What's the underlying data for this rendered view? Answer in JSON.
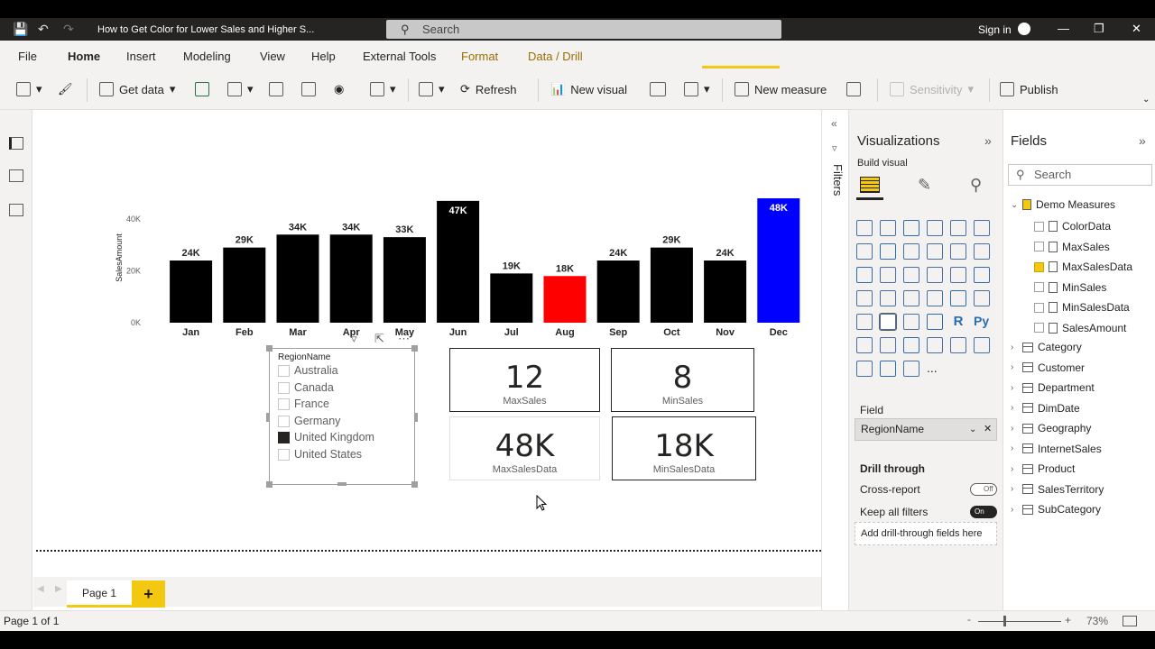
{
  "titlebar": {
    "title": "How to Get Color for Lower Sales and Higher S...",
    "search": "Search",
    "signin": "Sign in"
  },
  "menu": [
    "File",
    "Home",
    "Insert",
    "Modeling",
    "View",
    "Help",
    "External Tools",
    "Format",
    "Data / Drill"
  ],
  "ribbon": {
    "get_data": "Get data",
    "refresh": "Refresh",
    "new_visual": "New visual",
    "new_measure": "New measure",
    "sensitivity": "Sensitivity",
    "publish": "Publish"
  },
  "chart_data": {
    "type": "bar",
    "categories": [
      "Jan",
      "Feb",
      "Mar",
      "Apr",
      "May",
      "Jun",
      "Jul",
      "Aug",
      "Sep",
      "Oct",
      "Nov",
      "Dec"
    ],
    "values": [
      24,
      29,
      34,
      34,
      33,
      47,
      19,
      18,
      24,
      29,
      24,
      48
    ],
    "labels": [
      "24K",
      "29K",
      "34K",
      "34K",
      "33K",
      "47K",
      "19K",
      "18K",
      "24K",
      "29K",
      "24K",
      "48K"
    ],
    "colors": [
      "#000000",
      "#000000",
      "#000000",
      "#000000",
      "#000000",
      "#000000",
      "#000000",
      "#ff0000",
      "#000000",
      "#000000",
      "#000000",
      "#0000ff"
    ],
    "ylabel": "SalesAmount",
    "yticks": [
      "0K",
      "20K",
      "40K"
    ],
    "ylim": [
      0,
      48
    ]
  },
  "slicer": {
    "header": "RegionName",
    "options": [
      {
        "label": "Australia",
        "checked": false
      },
      {
        "label": "Canada",
        "checked": false
      },
      {
        "label": "France",
        "checked": false
      },
      {
        "label": "Germany",
        "checked": false
      },
      {
        "label": "United Kingdom",
        "checked": true
      },
      {
        "label": "United States",
        "checked": false
      }
    ]
  },
  "cards": [
    {
      "value": "12",
      "label": "MaxSales"
    },
    {
      "value": "8",
      "label": "MinSales"
    },
    {
      "value": "48K",
      "label": "MaxSalesData"
    },
    {
      "value": "18K",
      "label": "MinSalesData"
    }
  ],
  "pages": {
    "tab": "Page 1",
    "add": "+"
  },
  "status": {
    "page": "Page 1 of 1",
    "zoom": "73%"
  },
  "filters": "Filters",
  "visualizations": {
    "title": "Visualizations",
    "build": "Build visual",
    "field_label": "Field",
    "field_value": "RegionName",
    "drill": "Drill through",
    "cross_report": "Cross-report",
    "cross_report_state": "Off",
    "keep_filters": "Keep all filters",
    "keep_filters_state": "On",
    "dropzone": "Add drill-through fields here",
    "more": "..."
  },
  "fields": {
    "title": "Fields",
    "search": "Search",
    "group": "Demo Measures",
    "measures": [
      {
        "name": "ColorData",
        "checked": false
      },
      {
        "name": "MaxSales",
        "checked": false
      },
      {
        "name": "MaxSalesData",
        "checked": true
      },
      {
        "name": "MinSales",
        "checked": false
      },
      {
        "name": "MinSalesData",
        "checked": false
      },
      {
        "name": "SalesAmount",
        "checked": false
      }
    ],
    "tables": [
      "Category",
      "Customer",
      "Department",
      "DimDate",
      "Geography",
      "InternetSales",
      "Product",
      "SalesTerritory",
      "SubCategory"
    ]
  }
}
